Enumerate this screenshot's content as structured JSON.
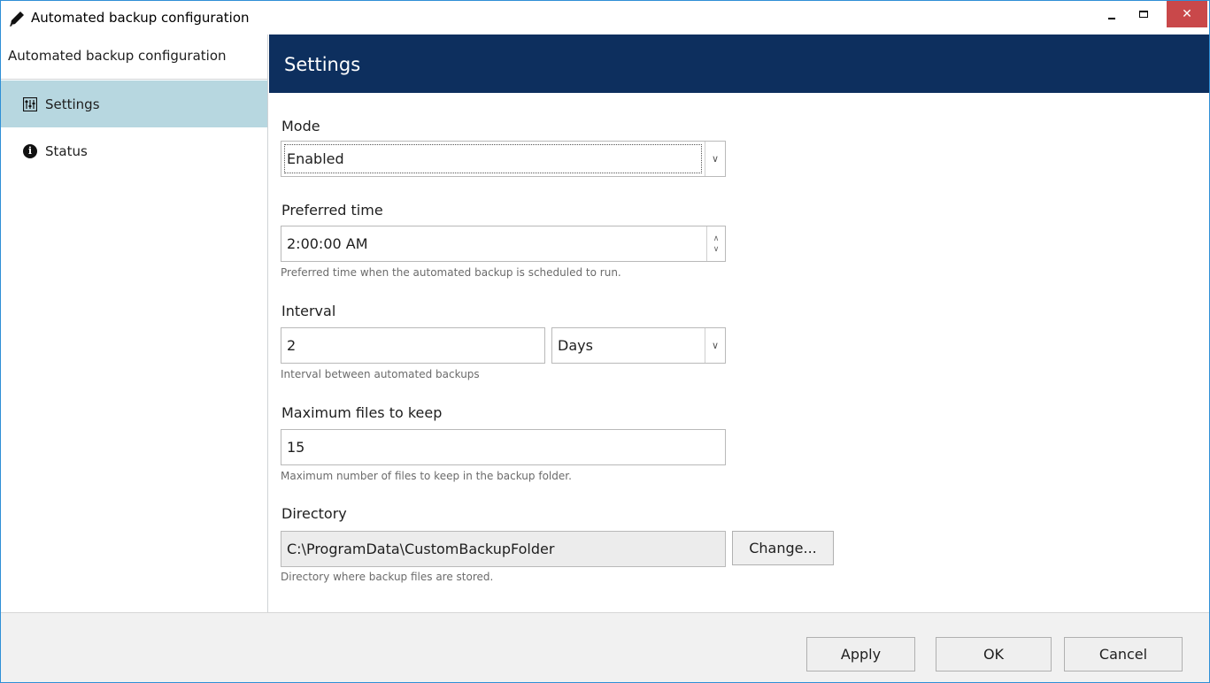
{
  "window": {
    "title": "Automated backup configuration",
    "close_glyph": "✕"
  },
  "sidebar": {
    "header": "Automated backup configuration",
    "items": [
      {
        "label": "Settings",
        "icon": "sliders-icon",
        "active": true
      },
      {
        "label": "Status",
        "icon": "info-icon",
        "active": false
      }
    ]
  },
  "main": {
    "title": "Settings",
    "mode": {
      "label": "Mode",
      "value": "Enabled"
    },
    "preferred_time": {
      "label": "Preferred time",
      "value": "2:00:00 AM",
      "hint": "Preferred time when the automated backup is scheduled to run."
    },
    "interval": {
      "label": "Interval",
      "value": "2",
      "unit": "Days",
      "hint": "Interval between automated backups"
    },
    "max_files": {
      "label": "Maximum files to keep",
      "value": "15",
      "hint": "Maximum number of files to keep in the backup folder."
    },
    "directory": {
      "label": "Directory",
      "value": "C:\\ProgramData\\CustomBackupFolder",
      "change_label": "Change...",
      "hint": "Directory where backup files are stored."
    }
  },
  "footer": {
    "apply_label": "Apply",
    "ok_label": "OK",
    "cancel_label": "Cancel"
  },
  "colors": {
    "header_bg": "#0d2f5e",
    "active_nav_bg": "#b7d7e0",
    "close_bg": "#c9484a",
    "window_border": "#2f8fd6"
  }
}
